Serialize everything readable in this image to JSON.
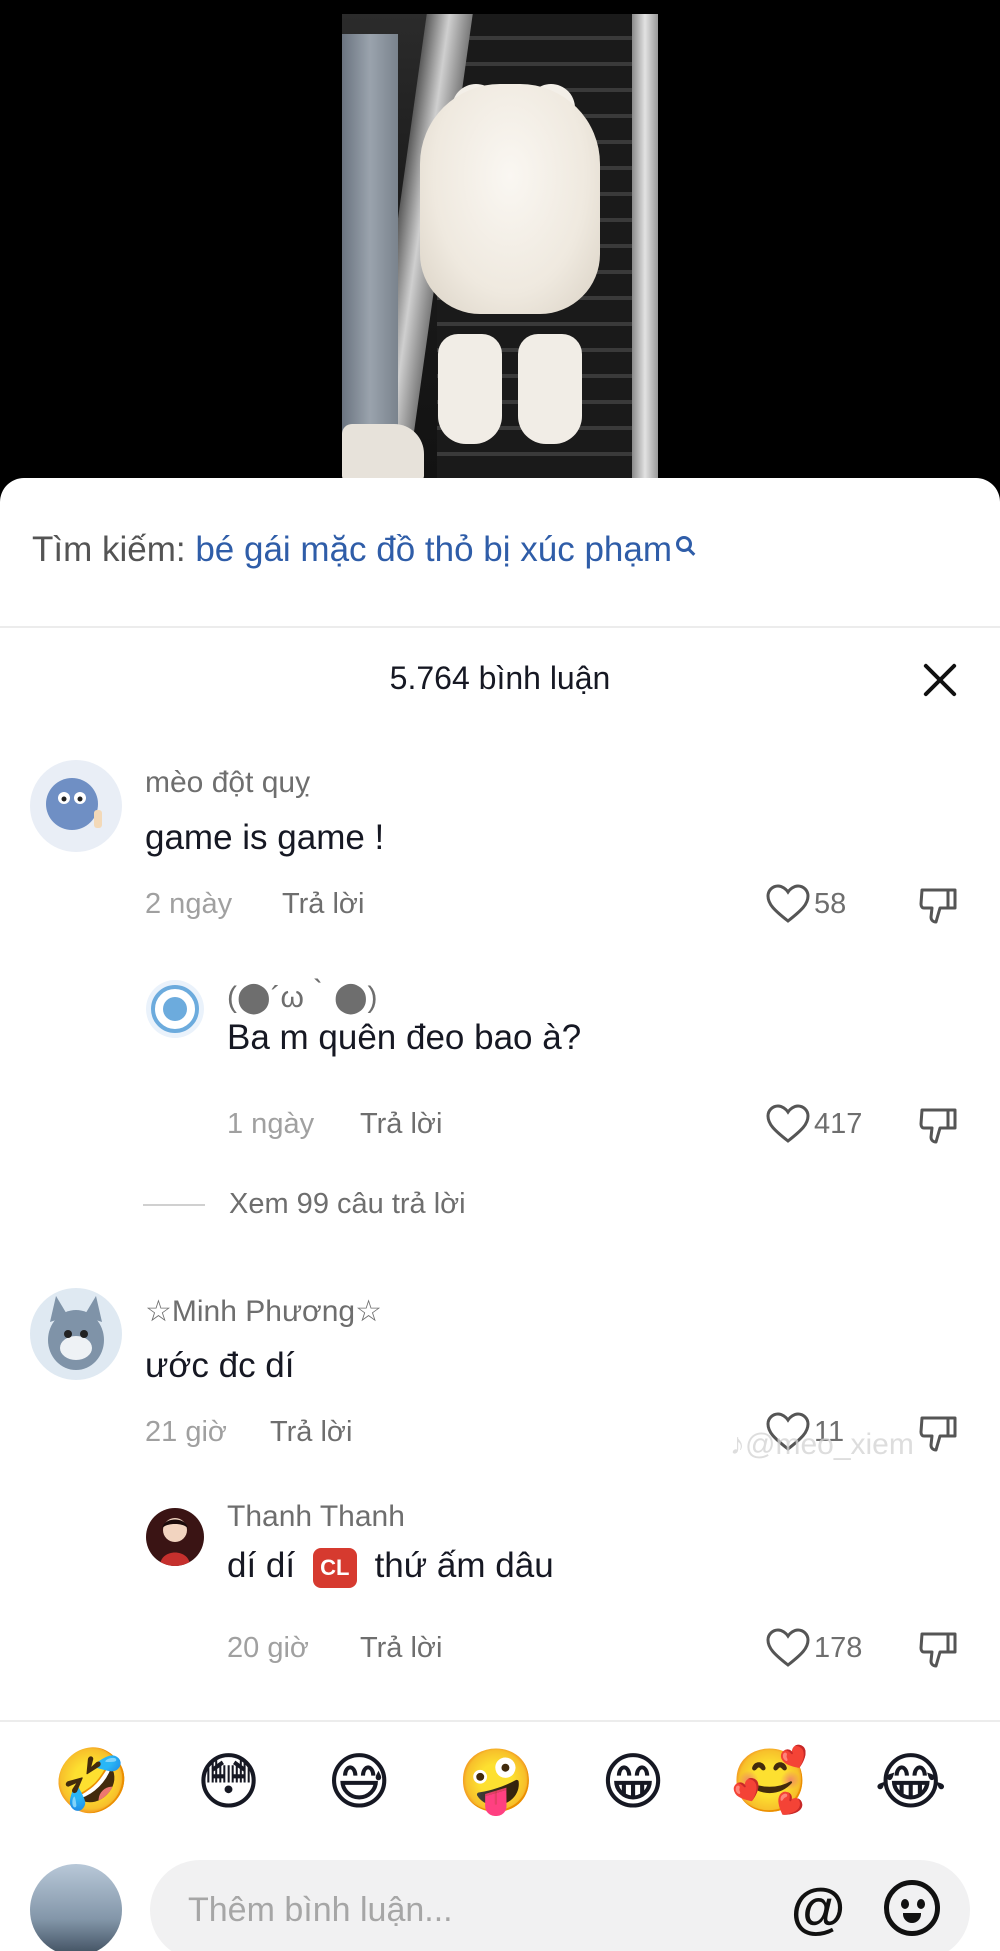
{
  "search": {
    "prefix": "Tìm kiếm:",
    "query": "bé gái mặc đồ thỏ bị xúc phạm"
  },
  "header": {
    "comment_count": "5.764 bình luận"
  },
  "comments": [
    {
      "username": "mèo đột quỵ",
      "text": "game is game !",
      "time": "2 ngày",
      "reply_label": "Trả lời",
      "likes": "58",
      "reply": {
        "username": "(⬤´ω｀⬤)",
        "text": "Ba m quên đeo bao à?",
        "time": "1 ngày",
        "reply_label": "Trả lời",
        "likes": "417"
      },
      "view_replies": "Xem 99 câu trả lời"
    },
    {
      "username": "☆Minh Phương☆",
      "text": "ước đc dí",
      "time": "21 giờ",
      "reply_label": "Trả lời",
      "likes": "11",
      "reply": {
        "username": "Thanh Thanh",
        "text_before": "dí dí",
        "text_after": "thứ ấm dâu",
        "time": "20 giờ",
        "reply_label": "Trả lời",
        "likes": "178"
      }
    }
  ],
  "watermark": "♪@meo_xiem",
  "emojis": [
    "🤣",
    "😳",
    "😅",
    "🤪",
    "😁",
    "🥰",
    "😂"
  ],
  "composer": {
    "placeholder": "Thêm bình luận...",
    "at_label": "@"
  },
  "colors": {
    "search_link": "#2f5da8",
    "secondary_text": "#6e6e6e",
    "meta_text": "#a0a0a0"
  }
}
